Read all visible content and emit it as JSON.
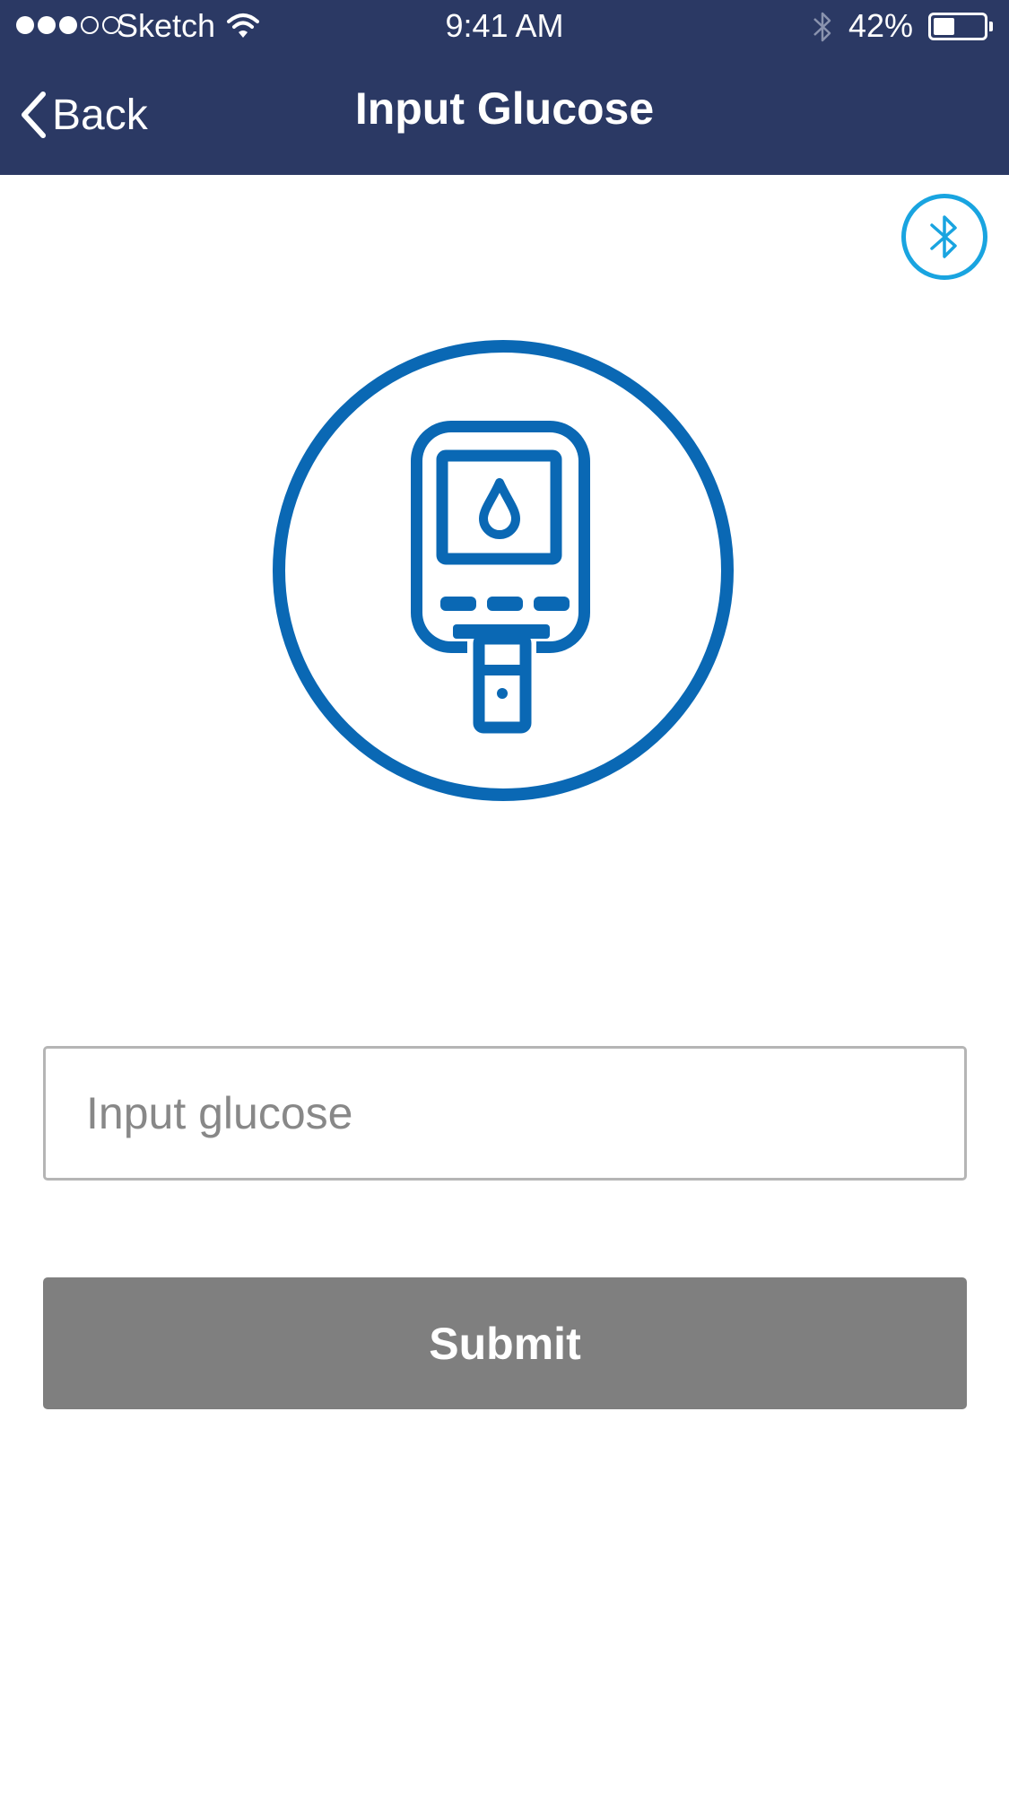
{
  "status_bar": {
    "carrier": "Sketch",
    "signal_bars_filled": 3,
    "signal_bars_total": 5,
    "time": "9:41 AM",
    "battery_percent": "42%",
    "battery_level": 0.42,
    "icons": [
      "wifi-icon",
      "bluetooth-status-icon",
      "battery-icon"
    ]
  },
  "nav": {
    "back_label": "Back",
    "title": "Input Glucose",
    "background_color": "#2b3964"
  },
  "bluetooth_button": {
    "icon": "bluetooth-icon",
    "color": "#19a4e0"
  },
  "illustration": {
    "icon": "glucose-meter-icon",
    "color": "#0a68b4"
  },
  "form": {
    "glucose_value": "",
    "glucose_placeholder": "Input glucose",
    "submit_label": "Submit",
    "submit_color": "#7f7f7f"
  }
}
